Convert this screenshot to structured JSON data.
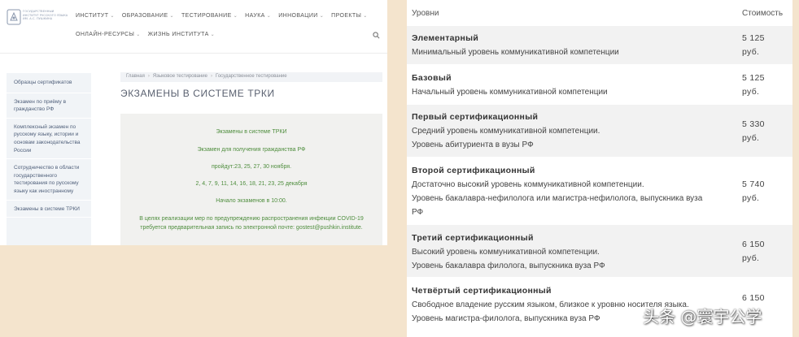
{
  "colors": {
    "background": "#f4e4cd",
    "notice_text": "#4e8d3d",
    "sidebar_text": "#4f5f7a",
    "row_shade": "#f2f2f2"
  },
  "site": {
    "logo_text": "Государственный институт русского языка им. А.С. Пушкина",
    "nav_primary": [
      {
        "label": "Институт"
      },
      {
        "label": "Образование"
      },
      {
        "label": "Тестирование"
      },
      {
        "label": "Наука"
      },
      {
        "label": "Инновации"
      },
      {
        "label": "Проекты"
      }
    ],
    "nav_secondary": [
      {
        "label": "Онлайн-ресурсы"
      },
      {
        "label": "Жизнь института"
      }
    ],
    "search_icon": "search-icon"
  },
  "sidebar": {
    "items": [
      {
        "label": "Образцы сертификатов"
      },
      {
        "label": "Экзамен по приёму в гражданство РФ"
      },
      {
        "label": "Комплексный экзамен по русскому языку, истории и основам законодательства России"
      },
      {
        "label": "Сотрудничество в области государственного тестирования по русскому языку как иностранному"
      },
      {
        "label": "Экзамены в системе ТРКИ"
      }
    ]
  },
  "breadcrumb": {
    "items": [
      "Главная",
      "Языковое тестирование",
      "Государственное тестирование"
    ]
  },
  "page_title": "Экзамены в системе ТРКИ",
  "notice": {
    "line1": "Экзамены в системе ТРКИ",
    "line2": "Экзамен для получения гражданства РФ",
    "line3": "пройдут:23, 25, 27, 30 ноября.",
    "line4": "2, 4, 7, 9, 11, 14, 16, 18, 21, 23, 25 декабря",
    "line5": "Начало экзаменов в 10:00.",
    "line6": "В целях реализации мер по предупреждению распространения инфекции COVID-19 требуется предварительная запись по электронной почте: gostest@pushkin.institute."
  },
  "table": {
    "headers": {
      "level": "Уровни",
      "cost": "Стоимость"
    },
    "rows": [
      {
        "name": "Элементарный",
        "desc1": "Минимальный уровень коммуникативной компетенции",
        "desc2": "",
        "desc3": "",
        "price": "5 125",
        "unit": "руб."
      },
      {
        "name": "Базовый",
        "desc1": "Начальный уровень коммуникативной компетенции",
        "desc2": "",
        "desc3": "",
        "price": "5 125",
        "unit": "руб."
      },
      {
        "name": "Первый сертификационный",
        "desc1": "Средний уровень коммуникативной компетенции.",
        "desc2": "Уровень абитуриента в вузы РФ",
        "desc3": "",
        "price": "5 330",
        "unit": "руб."
      },
      {
        "name": "Второй сертификационный",
        "desc1": "Достаточно высокий уровень коммуникативной компетенции.",
        "desc2": "Уровень бакалавра-нефилолога или магистра-нефилолога, выпускника вуза",
        "desc3": "РФ",
        "price": "5 740",
        "unit": "руб."
      },
      {
        "name": "Третий сертификационный",
        "desc1": "Высокий уровень коммуникативной компетенции.",
        "desc2": "Уровень бакалавра филолога, выпускника вуза РФ",
        "desc3": "",
        "price": "6 150",
        "unit": "руб."
      },
      {
        "name": "Четвёртый сертификационный",
        "desc1": "Свободное владение русским языком, близкое к уровню носителя языка.",
        "desc2": "Уровень магистра-филолога, выпускника вуза РФ",
        "desc3": "",
        "price": "6 150",
        "unit": ""
      }
    ]
  },
  "watermark": "头条 @寰宇公学"
}
